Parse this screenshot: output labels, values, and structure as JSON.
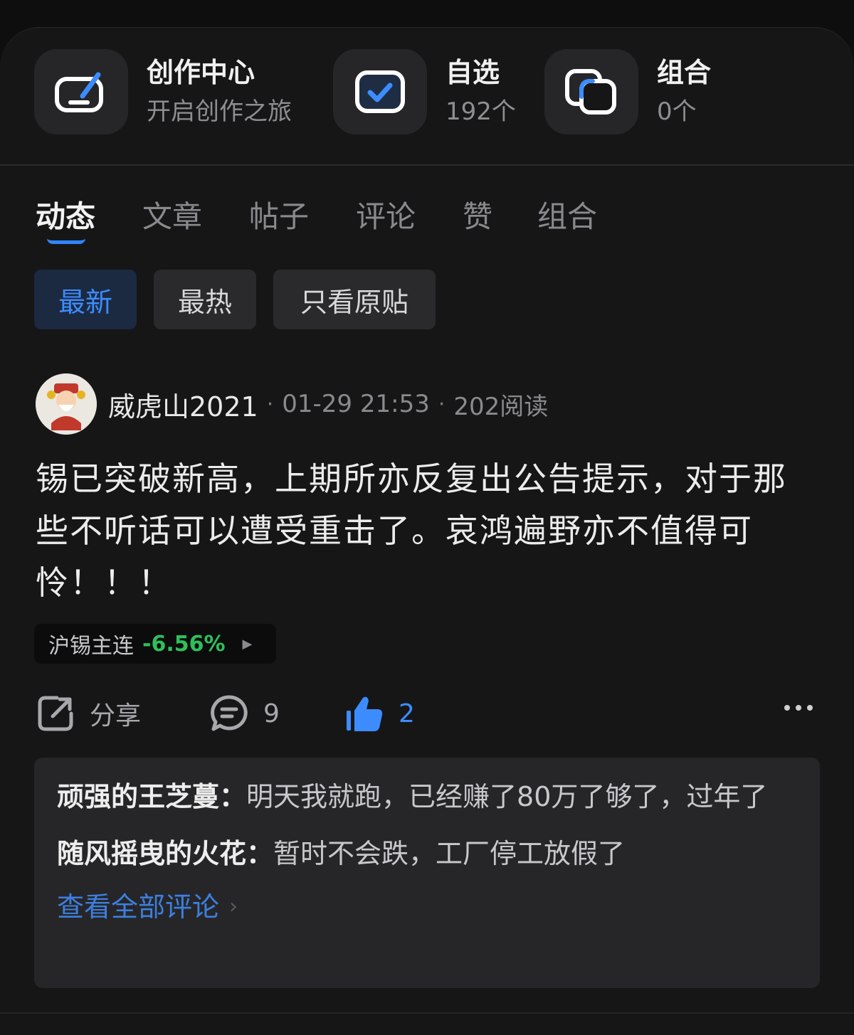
{
  "shortcuts": [
    {
      "title": "创作中心",
      "subtitle": "开启创作之旅",
      "icon": "create-edit-icon"
    },
    {
      "title": "自选",
      "subtitle": "192个",
      "icon": "checkbox-icon"
    },
    {
      "title": "组合",
      "subtitle": "0个",
      "icon": "portfolio-icon"
    }
  ],
  "tabs": [
    "动态",
    "文章",
    "帖子",
    "评论",
    "赞",
    "组合"
  ],
  "active_tab": "动态",
  "filters": [
    "最新",
    "最热",
    "只看原贴"
  ],
  "active_filter": "最新",
  "post": {
    "author": "威虎山2021",
    "time": "01-29 21:53",
    "reads": "202阅读",
    "body": "锡已突破新高，上期所亦反复出公告提示，对于那些不听话可以遭受重击了。哀鸿遍野亦不值得可怜！！！",
    "stock": {
      "name": "沪锡主连",
      "change": "-6.56%"
    },
    "share_label": "分享",
    "comment_count": "9",
    "like_count": "2"
  },
  "comments": [
    {
      "user": "顽强的王芝蔓：",
      "text": "明天我就跑，已经赚了80万了够了，过年了"
    },
    {
      "user": "随风摇曳的火花：",
      "text": "暂时不会跌，工厂停工放假了"
    }
  ],
  "view_all_label": "查看全部评论",
  "colors": {
    "accent": "#3d8cff",
    "down_green": "#2fbf5a",
    "background": "#161617"
  }
}
